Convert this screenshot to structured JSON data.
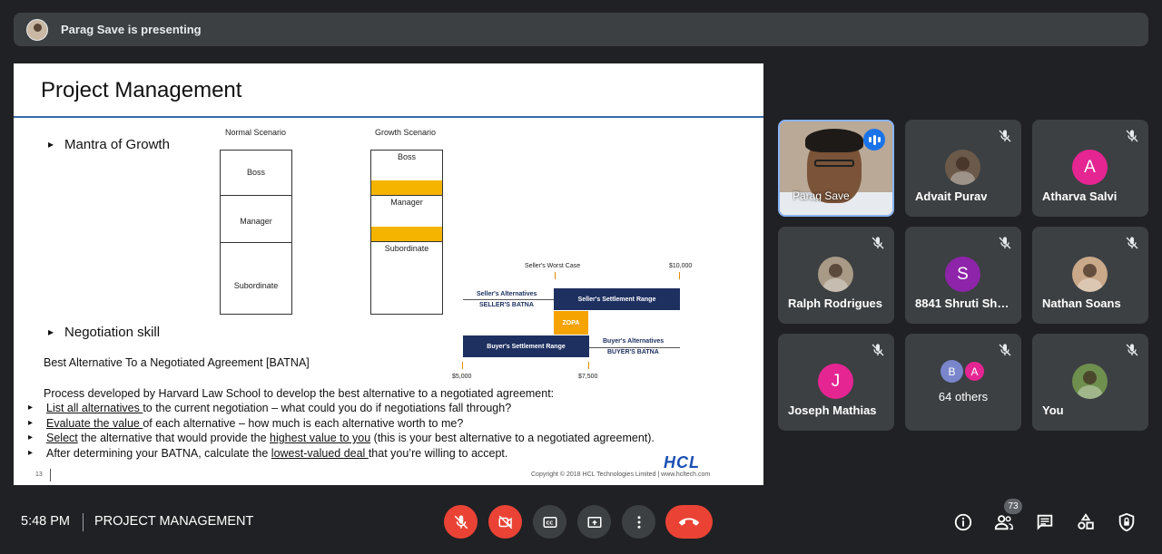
{
  "presenting": {
    "text": "Parag Save is presenting"
  },
  "slide": {
    "title": "Project Management",
    "bullet_mantra": "Mantra of Growth",
    "bullet_negotiation": "Negotiation skill",
    "normal_heading": "Normal Scenario",
    "growth_heading": "Growth Scenario",
    "normal_boxes": [
      "Boss",
      "Manager",
      "Subordinate"
    ],
    "growth_boxes": [
      "Boss",
      "Manager",
      "Subordinate"
    ],
    "batna_title": "Best Alternative To a Negotiated Agreement [BATNA]",
    "process_intro": "Process developed by Harvard Law School to develop the best alternative to a negotiated agreement:",
    "list": [
      {
        "u": "List all alternatives ",
        "rest": "to the current negotiation – what could you do if negotiations fall through?"
      },
      {
        "u": "Evaluate the value ",
        "rest": "of each alternative – how much is each alternative worth to me?"
      },
      {
        "pre": "",
        "u": "Select",
        "mid": " the alternative that would provide the ",
        "u2": "highest value to you",
        "rest": " (this is your best alternative to a negotiated agreement)."
      },
      {
        "pre": "After determining your BATNA, calculate the ",
        "u": "lowest-valued deal ",
        "rest": "that you’re willing to accept."
      }
    ],
    "diagram": {
      "seller_worst": "Seller's Worst Case",
      "top_value": "$10,000",
      "seller_alternatives": "Seller's Alternatives",
      "seller_batna": "SELLER'S BATNA",
      "seller_range": "Seller's Settlement Range",
      "zopa": "ZOPA",
      "buyer_range": "Buyer's Settlement Range",
      "buyer_alternatives": "Buyer's Alternatives",
      "buyer_batna": "BUYER'S BATNA",
      "low_value": "$5,000",
      "mid_value": "$7,500"
    },
    "logo": "HCL",
    "copyright": "Copyright © 2018 HCL Technologies Limited  |  www.hcltech.com",
    "page_number": "13"
  },
  "participants": [
    {
      "name": "Parag Save",
      "type": "video"
    },
    {
      "name": "Advait Purav",
      "type": "photo",
      "color": "#6b5a4a"
    },
    {
      "name": "Atharva Salvi",
      "type": "letter",
      "letter": "A",
      "color": "#e52592"
    },
    {
      "name": "Ralph Rodrigues",
      "type": "photo",
      "color": "#a89a86"
    },
    {
      "name": "8841 Shruti Shetty",
      "type": "letter",
      "letter": "S",
      "color": "#8e24aa"
    },
    {
      "name": "Nathan Soans",
      "type": "photo",
      "color": "#c9a98a"
    },
    {
      "name": "Joseph Mathias",
      "type": "letter",
      "letter": "J",
      "color": "#e52592"
    },
    {
      "name": "64 others",
      "type": "others",
      "letters": [
        "B",
        "A"
      ]
    },
    {
      "name": "You",
      "type": "photo",
      "color": "#6f8f4e"
    }
  ],
  "bottom": {
    "time": "5:48 PM",
    "meeting_title": "PROJECT MANAGEMENT",
    "people_count": "73"
  }
}
